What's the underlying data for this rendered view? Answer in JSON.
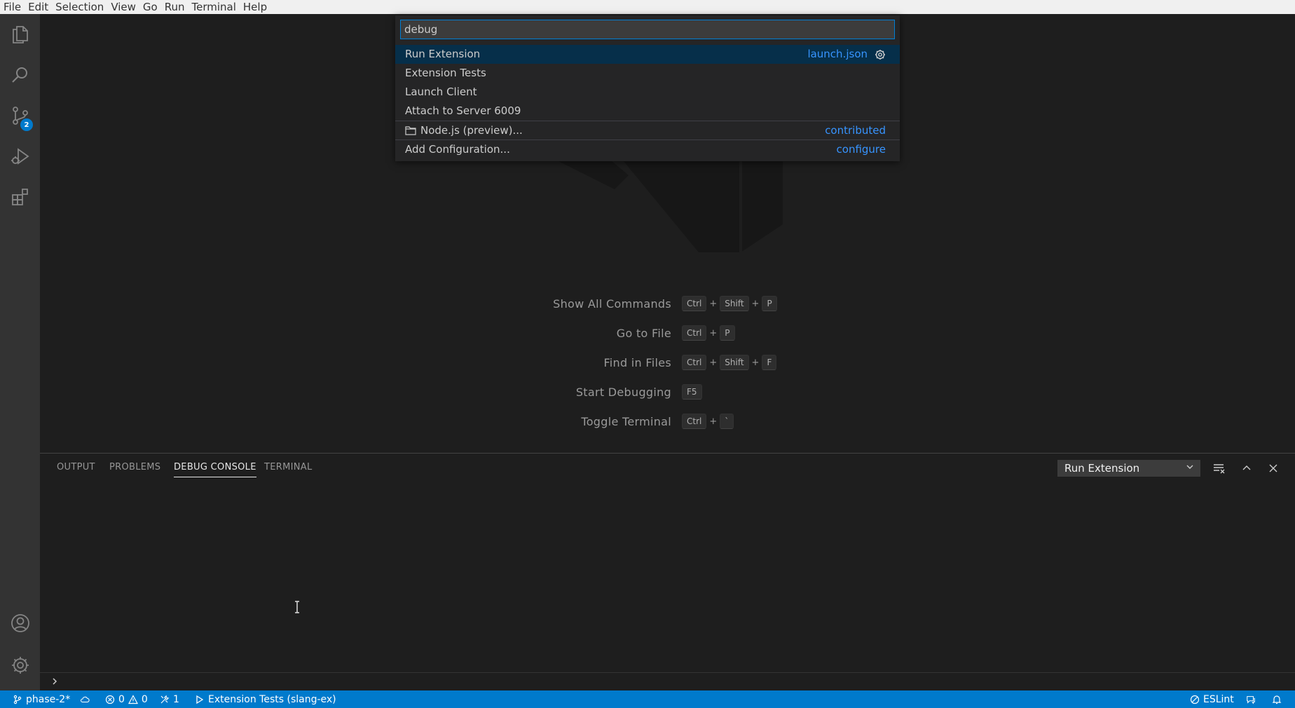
{
  "menubar": {
    "items": [
      "File",
      "Edit",
      "Selection",
      "View",
      "Go",
      "Run",
      "Terminal",
      "Help"
    ]
  },
  "activitybar": {
    "scm_badge": "2"
  },
  "quickpick": {
    "input_value": "debug",
    "items": [
      {
        "label": "Run Extension",
        "description": "launch.json"
      },
      {
        "label": "Extension Tests",
        "description": ""
      },
      {
        "label": "Launch Client",
        "description": ""
      },
      {
        "label": "Attach to Server 6009",
        "description": ""
      },
      {
        "label": "Node.js (preview)...",
        "description": "contributed"
      },
      {
        "label": "Add Configuration...",
        "description": "configure"
      }
    ]
  },
  "welcome": {
    "shortcuts": [
      {
        "label": "Show All Commands",
        "keys": [
          "Ctrl",
          "Shift",
          "P"
        ]
      },
      {
        "label": "Go to File",
        "keys": [
          "Ctrl",
          "P"
        ]
      },
      {
        "label": "Find in Files",
        "keys": [
          "Ctrl",
          "Shift",
          "F"
        ]
      },
      {
        "label": "Start Debugging",
        "keys": [
          "F5"
        ]
      },
      {
        "label": "Toggle Terminal",
        "keys": [
          "Ctrl",
          "`"
        ]
      }
    ]
  },
  "panel": {
    "tabs": [
      "OUTPUT",
      "PROBLEMS",
      "DEBUG CONSOLE",
      "TERMINAL"
    ],
    "active_tab": "DEBUG CONSOLE",
    "config_select": "Run Extension"
  },
  "statusbar": {
    "branch": "phase-2*",
    "errors": "0",
    "warnings": "0",
    "ports": "1",
    "debug_config": "Extension Tests (slang-ex)",
    "eslint": "ESLint"
  },
  "colors": {
    "accent": "#007acc",
    "link": "#3794ff",
    "selection": "#062f4a"
  }
}
